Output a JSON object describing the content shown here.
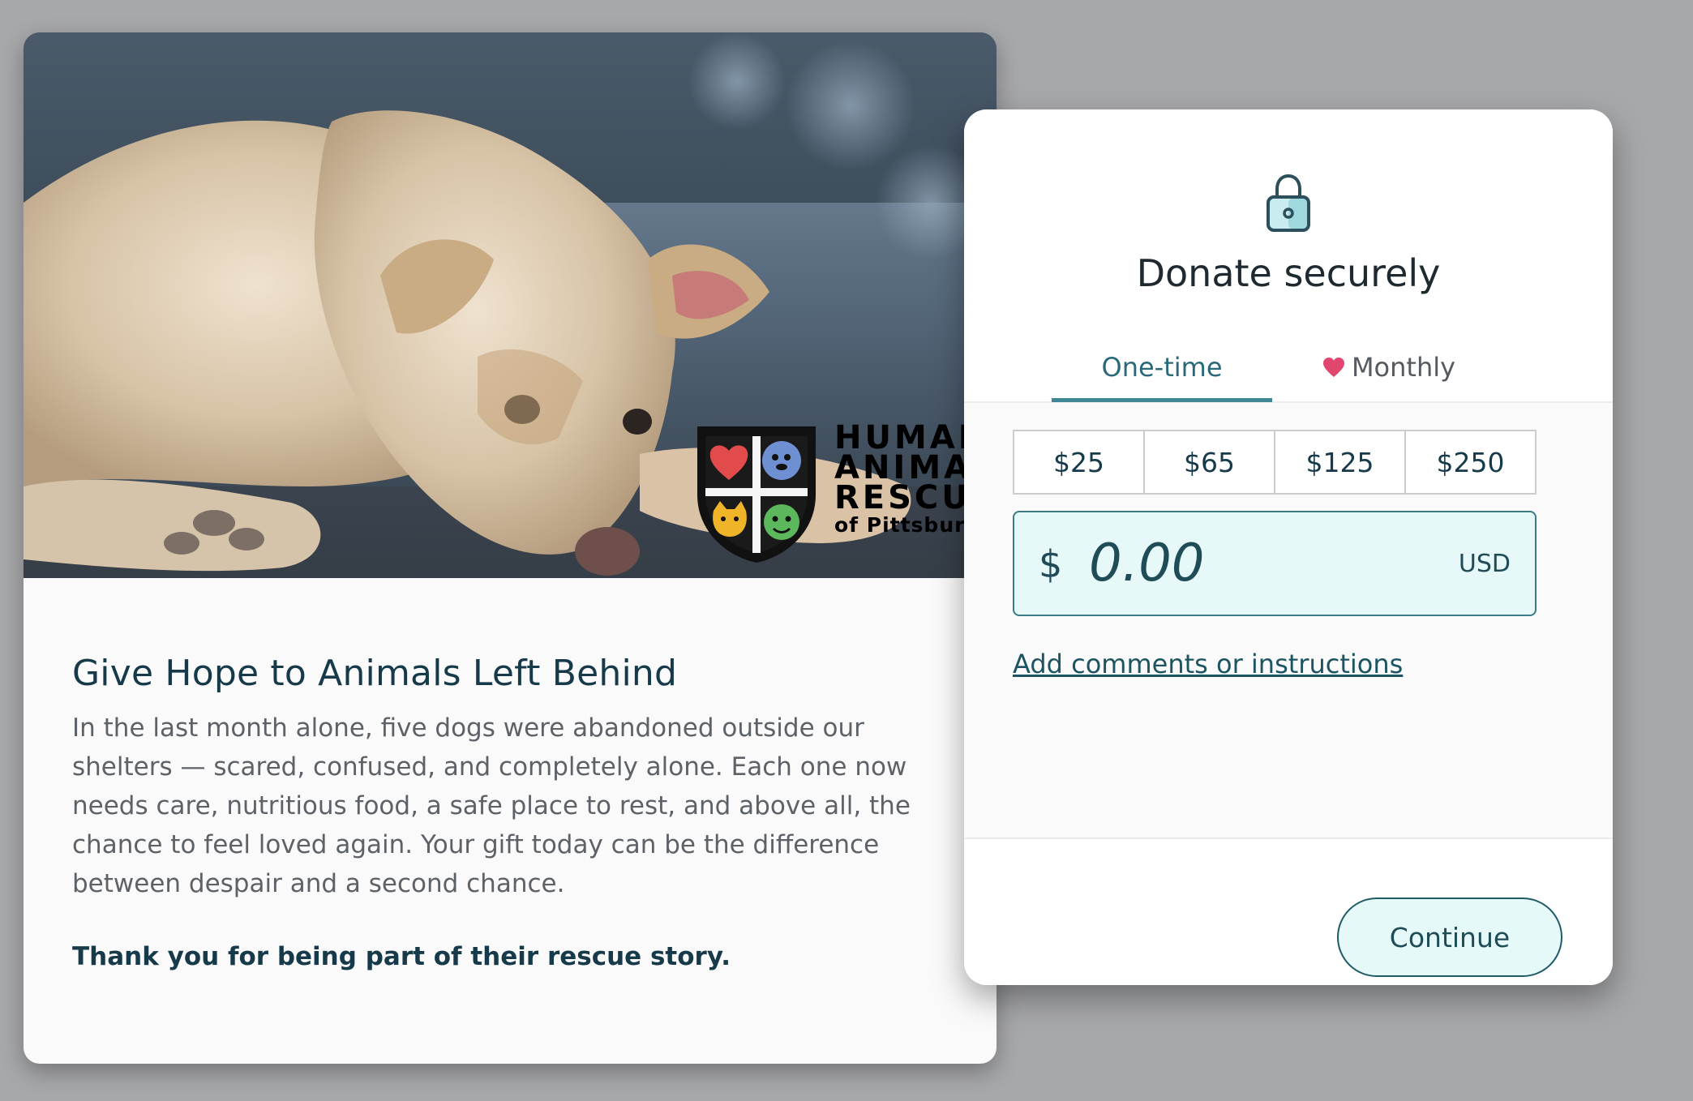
{
  "story": {
    "title": "Give Hope to Animals Left Behind",
    "body": "In the last month alone, five dogs were abandoned outside our shelters — scared, confused, and completely alone. Each one now needs care, nutritious food, a safe place to rest, and above all, the chance to feel loved again. Your gift today can be the difference between despair and a second chance.",
    "thanks": "Thank you for being part of their rescue story.",
    "logo": {
      "line1": "HUMANE",
      "line2": "ANIMAL",
      "line3": "RESCUE",
      "line4": "of Pittsburgh"
    }
  },
  "donate": {
    "title": "Donate securely",
    "tabs": [
      {
        "label": "One-time",
        "active": true
      },
      {
        "label": "Monthly",
        "active": false
      }
    ],
    "presets": [
      "$25",
      "$65",
      "$125",
      "$250"
    ],
    "amount": {
      "symbol": "$",
      "value": "0.00",
      "currency": "USD"
    },
    "comments_link": "Add comments or instructions",
    "continue_label": "Continue"
  },
  "colors": {
    "background": "#a7a8aa",
    "accent": "#3f8795",
    "title_text": "#163a4a",
    "amount_field_bg": "#e6f8f8",
    "heart": "#e0466e"
  },
  "icons": [
    "lock-icon",
    "heart-icon"
  ]
}
